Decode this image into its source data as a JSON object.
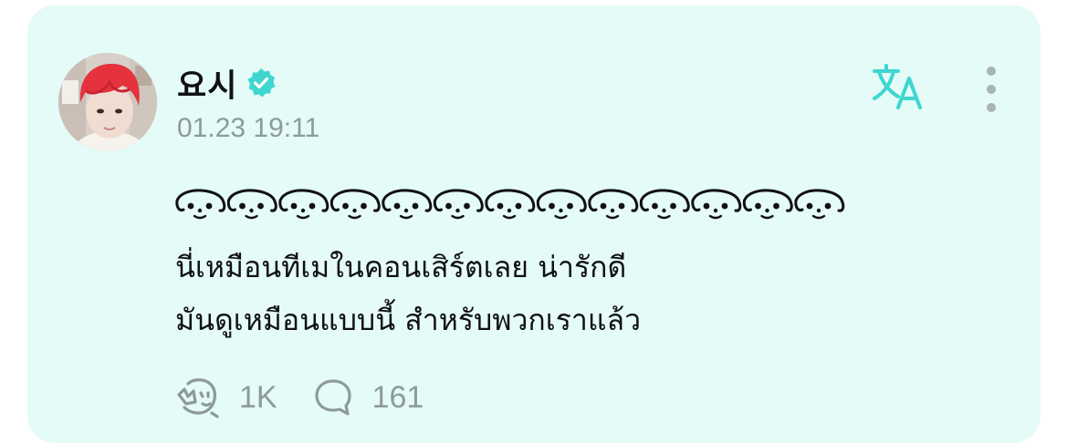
{
  "post": {
    "author": {
      "name": "요시",
      "verified": true
    },
    "timestamp": "01.23 19:11",
    "emoji_faces_count": 13,
    "text_lines": [
      "นี่เหมือนทีเมในคอนเสิร์ตเลย น่ารักดี",
      "มันดูเหมือนแบบนี้ สำหรับพวกเราแล้ว"
    ],
    "likes": "1K",
    "comments": "161"
  },
  "icons": {
    "verified": "verified-badge-icon",
    "translate": "translate-icon",
    "more": "more-vertical-icon",
    "like": "like-face-icon",
    "comment": "comment-bubble-icon"
  },
  "colors": {
    "card_background": "#e4fbf8",
    "accent": "#3fd6d0",
    "muted_text": "#8e9a9a",
    "body_text": "#111111",
    "avatar_hair": "#e5323c"
  }
}
